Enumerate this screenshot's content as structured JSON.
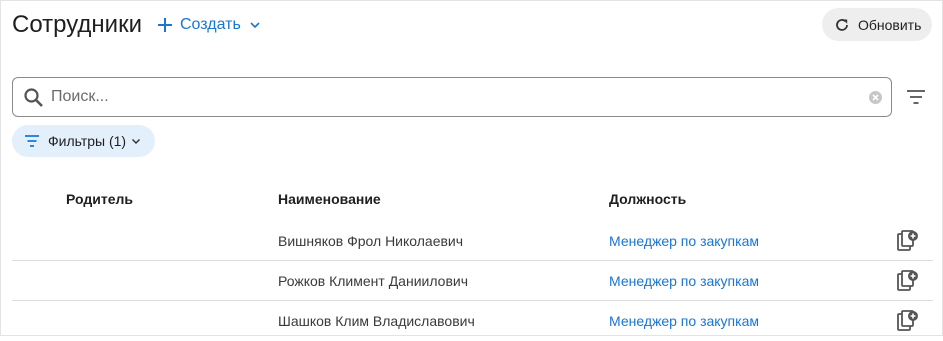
{
  "header": {
    "title": "Сотрудники",
    "create_label": "Создать",
    "refresh_label": "Обновить"
  },
  "search": {
    "placeholder": "Поиск...",
    "value": ""
  },
  "filters": {
    "chip_label": "Фильтры (1)"
  },
  "table": {
    "columns": [
      "Родитель",
      "Наименование",
      "Должность"
    ],
    "rows": [
      {
        "parent": "",
        "name": "Вишняков Фрол Николаевич",
        "position": "Менеджер по закупкам"
      },
      {
        "parent": "",
        "name": "Рожков Климент Даниилович",
        "position": "Менеджер по закупкам"
      },
      {
        "parent": "",
        "name": "Шашков Клим Владиславович",
        "position": "Менеджер по закупкам"
      }
    ]
  },
  "colors": {
    "accent": "#1976d2",
    "chip_bg": "#e3f0fb",
    "button_bg": "#eeeeee"
  }
}
